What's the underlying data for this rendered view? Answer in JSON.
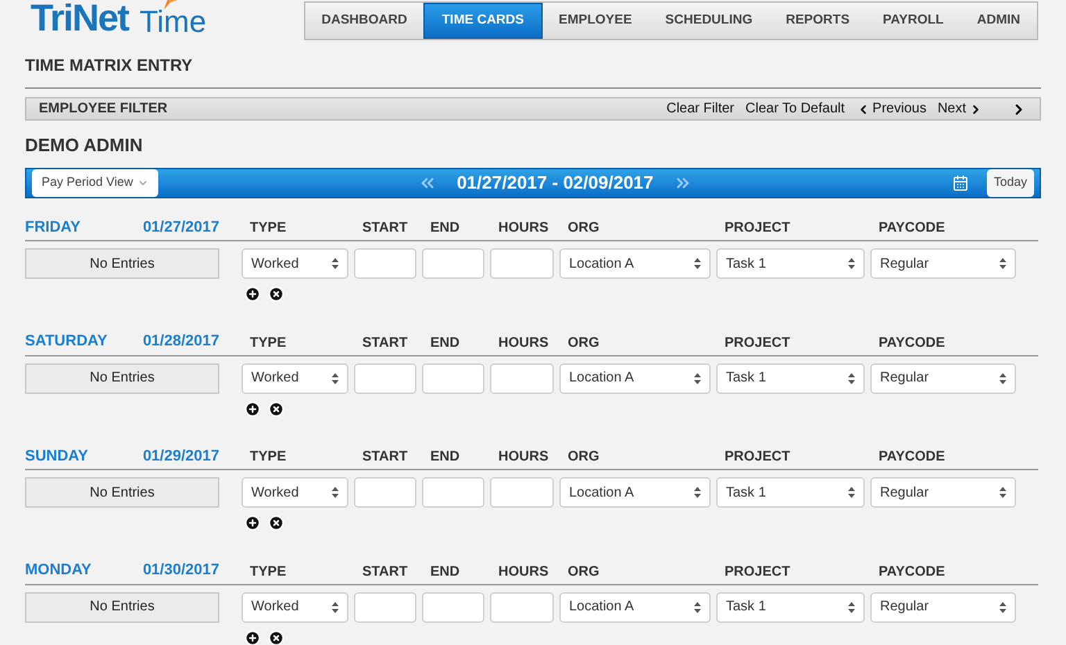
{
  "logo": {
    "brand": "TriNet",
    "product": "Time"
  },
  "nav": [
    {
      "label": "DASHBOARD",
      "selected": false
    },
    {
      "label": "TIME CARDS",
      "selected": true
    },
    {
      "label": "EMPLOYEE",
      "selected": false
    },
    {
      "label": "SCHEDULING",
      "selected": false
    },
    {
      "label": "REPORTS",
      "selected": false
    },
    {
      "label": "PAYROLL",
      "selected": false
    },
    {
      "label": "ADMIN",
      "selected": false
    }
  ],
  "page_title": "TIME MATRIX ENTRY",
  "filter": {
    "title": "EMPLOYEE FILTER",
    "clear_filter": "Clear Filter",
    "clear_default": "Clear To Default",
    "previous": "Previous",
    "next": "Next"
  },
  "employee": "DEMO ADMIN",
  "period_bar": {
    "view": "Pay Period View",
    "range": "01/27/2017 - 02/09/2017",
    "today": "Today"
  },
  "days": [
    {
      "day": "FRIDAY",
      "date": "01/27/2017",
      "columns": [
        "TYPE",
        "START",
        "END",
        "HOURS",
        "ORG",
        "PROJECT",
        "PAYCODE"
      ],
      "summary": "No Entries",
      "type": "Worked",
      "org": "Location A",
      "project": "Task 1",
      "paycode": "Regular"
    },
    {
      "day": "SATURDAY",
      "date": "01/28/2017",
      "columns": [
        "TYPE",
        "START",
        "END",
        "HOURS",
        "ORG",
        "PROJECT",
        "PAYCODE"
      ],
      "summary": "No Entries",
      "type": "Worked",
      "org": "Location A",
      "project": "Task 1",
      "paycode": "Regular"
    },
    {
      "day": "SUNDAY",
      "date": "01/29/2017",
      "columns": [
        "TYPE",
        "START",
        "END",
        "HOURS",
        "ORG",
        "PROJECT",
        "PAYCODE"
      ],
      "summary": "No Entries",
      "type": "Worked",
      "org": "Location A",
      "project": "Task 1",
      "paycode": "Regular"
    },
    {
      "day": "MONDAY",
      "date": "01/30/2017",
      "columns": [
        "TYPE",
        "START",
        "END",
        "HOURS",
        "ORG",
        "PROJECT",
        "PAYCODE"
      ],
      "summary": "No Entries",
      "type": "Worked",
      "org": "Location A",
      "project": "Task 1",
      "paycode": "Regular"
    }
  ]
}
